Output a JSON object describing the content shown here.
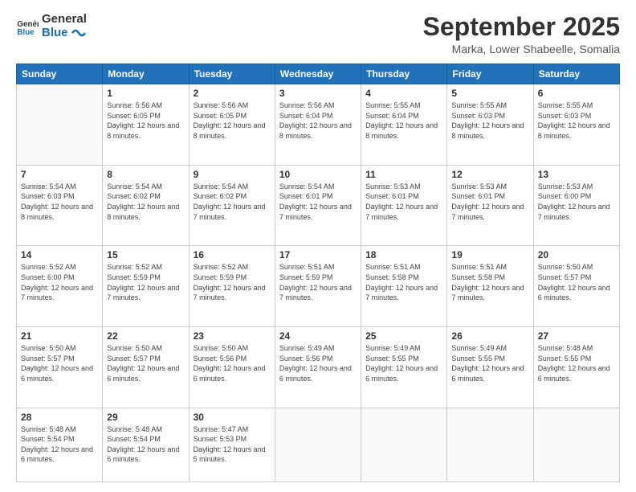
{
  "logo": {
    "text_general": "General",
    "text_blue": "Blue"
  },
  "header": {
    "month_title": "September 2025",
    "location": "Marka, Lower Shabeelle, Somalia"
  },
  "days_of_week": [
    "Sunday",
    "Monday",
    "Tuesday",
    "Wednesday",
    "Thursday",
    "Friday",
    "Saturday"
  ],
  "weeks": [
    [
      {
        "day": "",
        "empty": true
      },
      {
        "day": "1",
        "sunrise": "5:56 AM",
        "sunset": "6:05 PM",
        "daylight": "12 hours and 8 minutes."
      },
      {
        "day": "2",
        "sunrise": "5:56 AM",
        "sunset": "6:05 PM",
        "daylight": "12 hours and 8 minutes."
      },
      {
        "day": "3",
        "sunrise": "5:56 AM",
        "sunset": "6:04 PM",
        "daylight": "12 hours and 8 minutes."
      },
      {
        "day": "4",
        "sunrise": "5:55 AM",
        "sunset": "6:04 PM",
        "daylight": "12 hours and 8 minutes."
      },
      {
        "day": "5",
        "sunrise": "5:55 AM",
        "sunset": "6:03 PM",
        "daylight": "12 hours and 8 minutes."
      },
      {
        "day": "6",
        "sunrise": "5:55 AM",
        "sunset": "6:03 PM",
        "daylight": "12 hours and 8 minutes."
      }
    ],
    [
      {
        "day": "7",
        "sunrise": "5:54 AM",
        "sunset": "6:03 PM",
        "daylight": "12 hours and 8 minutes."
      },
      {
        "day": "8",
        "sunrise": "5:54 AM",
        "sunset": "6:02 PM",
        "daylight": "12 hours and 8 minutes."
      },
      {
        "day": "9",
        "sunrise": "5:54 AM",
        "sunset": "6:02 PM",
        "daylight": "12 hours and 7 minutes."
      },
      {
        "day": "10",
        "sunrise": "5:54 AM",
        "sunset": "6:01 PM",
        "daylight": "12 hours and 7 minutes."
      },
      {
        "day": "11",
        "sunrise": "5:53 AM",
        "sunset": "6:01 PM",
        "daylight": "12 hours and 7 minutes."
      },
      {
        "day": "12",
        "sunrise": "5:53 AM",
        "sunset": "6:01 PM",
        "daylight": "12 hours and 7 minutes."
      },
      {
        "day": "13",
        "sunrise": "5:53 AM",
        "sunset": "6:00 PM",
        "daylight": "12 hours and 7 minutes."
      }
    ],
    [
      {
        "day": "14",
        "sunrise": "5:52 AM",
        "sunset": "6:00 PM",
        "daylight": "12 hours and 7 minutes."
      },
      {
        "day": "15",
        "sunrise": "5:52 AM",
        "sunset": "5:59 PM",
        "daylight": "12 hours and 7 minutes."
      },
      {
        "day": "16",
        "sunrise": "5:52 AM",
        "sunset": "5:59 PM",
        "daylight": "12 hours and 7 minutes."
      },
      {
        "day": "17",
        "sunrise": "5:51 AM",
        "sunset": "5:59 PM",
        "daylight": "12 hours and 7 minutes."
      },
      {
        "day": "18",
        "sunrise": "5:51 AM",
        "sunset": "5:58 PM",
        "daylight": "12 hours and 7 minutes."
      },
      {
        "day": "19",
        "sunrise": "5:51 AM",
        "sunset": "5:58 PM",
        "daylight": "12 hours and 7 minutes."
      },
      {
        "day": "20",
        "sunrise": "5:50 AM",
        "sunset": "5:57 PM",
        "daylight": "12 hours and 6 minutes."
      }
    ],
    [
      {
        "day": "21",
        "sunrise": "5:50 AM",
        "sunset": "5:57 PM",
        "daylight": "12 hours and 6 minutes."
      },
      {
        "day": "22",
        "sunrise": "5:50 AM",
        "sunset": "5:57 PM",
        "daylight": "12 hours and 6 minutes."
      },
      {
        "day": "23",
        "sunrise": "5:50 AM",
        "sunset": "5:56 PM",
        "daylight": "12 hours and 6 minutes."
      },
      {
        "day": "24",
        "sunrise": "5:49 AM",
        "sunset": "5:56 PM",
        "daylight": "12 hours and 6 minutes."
      },
      {
        "day": "25",
        "sunrise": "5:49 AM",
        "sunset": "5:55 PM",
        "daylight": "12 hours and 6 minutes."
      },
      {
        "day": "26",
        "sunrise": "5:49 AM",
        "sunset": "5:55 PM",
        "daylight": "12 hours and 6 minutes."
      },
      {
        "day": "27",
        "sunrise": "5:48 AM",
        "sunset": "5:55 PM",
        "daylight": "12 hours and 6 minutes."
      }
    ],
    [
      {
        "day": "28",
        "sunrise": "5:48 AM",
        "sunset": "5:54 PM",
        "daylight": "12 hours and 6 minutes."
      },
      {
        "day": "29",
        "sunrise": "5:48 AM",
        "sunset": "5:54 PM",
        "daylight": "12 hours and 6 minutes."
      },
      {
        "day": "30",
        "sunrise": "5:47 AM",
        "sunset": "5:53 PM",
        "daylight": "12 hours and 5 minutes."
      },
      {
        "day": "",
        "empty": true
      },
      {
        "day": "",
        "empty": true
      },
      {
        "day": "",
        "empty": true
      },
      {
        "day": "",
        "empty": true
      }
    ]
  ]
}
